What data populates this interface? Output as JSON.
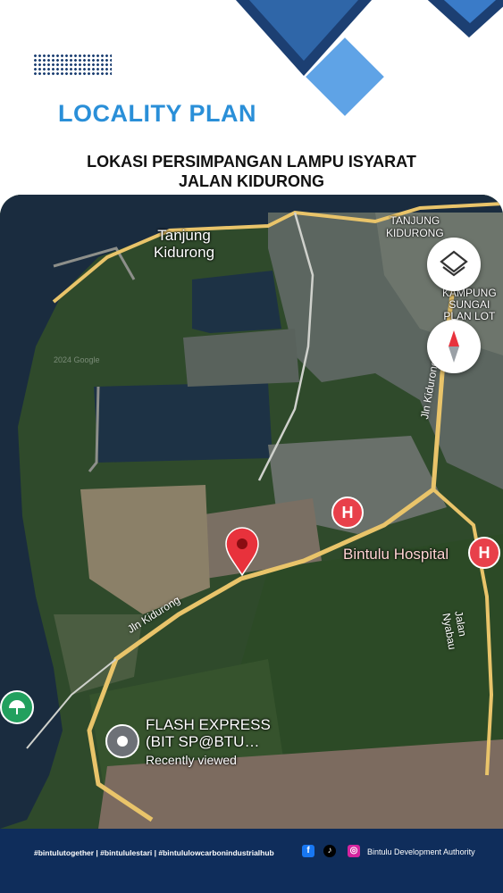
{
  "header": {
    "title": "LOCALITY PLAN",
    "subtitle_line1": "LOKASI PERSIMPANGAN LAMPU ISYARAT",
    "subtitle_line2": "JALAN KIDURONG"
  },
  "map": {
    "places": {
      "tanjung_kidurong_left": [
        "Tanjung",
        "Kidurong"
      ],
      "tanjung_kidurong_right": [
        "TANJUNG",
        "KIDURONG"
      ],
      "kampung_sungai": [
        "KAMPUNG",
        "SUNGAI",
        "PLAN LOT"
      ]
    },
    "roads": {
      "jln_kidurong_east": "Jln Kidurong",
      "jln_kidurong_west": "Jln Kidurong",
      "jalan_nyabau": "Jalan Nyabau"
    },
    "pois": {
      "hospital": "Bintulu Hospital",
      "flash_express_line1": "FLASH EXPRESS",
      "flash_express_line2": "(BIT SP@BTU…",
      "recently_viewed": "Recently viewed"
    },
    "watermark": "2024 Google",
    "controls": {
      "layers_icon": "layers-icon",
      "compass_icon": "compass-icon"
    },
    "colors": {
      "selected_pin": "#e8323c",
      "hospital_pin": "#e8404a",
      "road": "#e9c46a",
      "water": "#1a2c3f"
    }
  },
  "footer": {
    "hashtags": "#bintulutogether  |  #bintululestari  |  #bintululowcarbonindustrialhub",
    "organization": "Bintulu Development Authority",
    "social_icons": [
      "facebook-icon",
      "tiktok-icon",
      "instagram-icon"
    ]
  }
}
